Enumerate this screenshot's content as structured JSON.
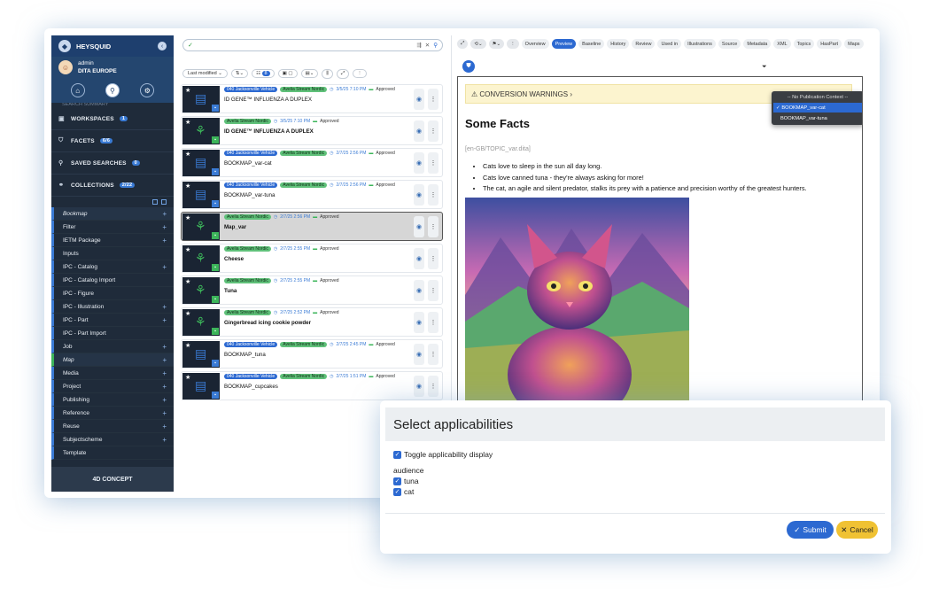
{
  "sidebar": {
    "brand": "HEYSQUID",
    "user_name": "admin",
    "user_org": "DITA EUROPE",
    "top_partial": "SEARCH SUMMARY",
    "sections": [
      {
        "label": "WORKSPACES",
        "badge": "1",
        "icon": "briefcase-icon"
      },
      {
        "label": "FACETS",
        "badge": "6/6",
        "icon": "tag-icon"
      },
      {
        "label": "SAVED SEARCHES",
        "badge": "0",
        "icon": "search-icon"
      },
      {
        "label": "COLLECTIONS",
        "badge": "2/22",
        "icon": "link-icon"
      }
    ],
    "items": [
      {
        "label": "Bookmap",
        "plus": true,
        "italic": true,
        "green": false
      },
      {
        "label": "Filter",
        "plus": true,
        "italic": false,
        "green": false
      },
      {
        "label": "IETM Package",
        "plus": true,
        "italic": false,
        "green": false
      },
      {
        "label": "Inputs",
        "plus": false,
        "italic": false,
        "green": false
      },
      {
        "label": "IPC - Catalog",
        "plus": true,
        "italic": false,
        "green": false
      },
      {
        "label": "IPC - Catalog Import",
        "plus": false,
        "italic": false,
        "green": false
      },
      {
        "label": "IPC - Figure",
        "plus": false,
        "italic": false,
        "green": false
      },
      {
        "label": "IPC - Illustration",
        "plus": true,
        "italic": false,
        "green": false
      },
      {
        "label": "IPC - Part",
        "plus": true,
        "italic": false,
        "green": false
      },
      {
        "label": "IPC - Part Import",
        "plus": false,
        "italic": false,
        "green": false
      },
      {
        "label": "Job",
        "plus": true,
        "italic": false,
        "green": false
      },
      {
        "label": "Map",
        "plus": true,
        "italic": true,
        "green": true
      },
      {
        "label": "Media",
        "plus": true,
        "italic": false,
        "green": false
      },
      {
        "label": "Project",
        "plus": true,
        "italic": false,
        "green": false
      },
      {
        "label": "Publishing",
        "plus": true,
        "italic": false,
        "green": false
      },
      {
        "label": "Reference",
        "plus": true,
        "italic": false,
        "green": false
      },
      {
        "label": "Reuse",
        "plus": true,
        "italic": false,
        "green": false
      },
      {
        "label": "Subjectscheme",
        "plus": true,
        "italic": false,
        "green": false
      },
      {
        "label": "Template",
        "plus": false,
        "italic": false,
        "green": false
      }
    ],
    "footer": "4D CONCEPT"
  },
  "list": {
    "sort_label": "Last modified",
    "count_badge": "8",
    "rows": [
      {
        "tag1": "040 Jacksonville Vehicle",
        "tag1_color": "blue",
        "tag2": "Avelia Stream Nordic",
        "date": "3/5/25 7:10 PM",
        "status": "Approved",
        "title": "ID GENE™ INFLUENZA A DUPLEX",
        "bold": false,
        "kind": "doc",
        "selected": false
      },
      {
        "tag1": "Avelia Stream Nordic",
        "tag1_color": "green",
        "tag2": "",
        "date": "3/5/25 7:10 PM",
        "status": "Approved",
        "title": "ID GENE™ INFLUENZA A DUPLEX",
        "bold": true,
        "kind": "map",
        "selected": false
      },
      {
        "tag1": "040 Jacksonville Vehicle",
        "tag1_color": "blue",
        "tag2": "Avelia Stream Nordic",
        "date": "2/7/25 2:56 PM",
        "status": "Approved",
        "title": "BOOKMAP_var-cat",
        "bold": false,
        "kind": "doc",
        "selected": false
      },
      {
        "tag1": "040 Jacksonville Vehicle",
        "tag1_color": "blue",
        "tag2": "Avelia Stream Nordic",
        "date": "2/7/25 2:56 PM",
        "status": "Approved",
        "title": "BOOKMAP_var-tuna",
        "bold": false,
        "kind": "doc",
        "selected": false
      },
      {
        "tag1": "Avelia Stream Nordic",
        "tag1_color": "green",
        "tag2": "",
        "date": "2/7/25 2:56 PM",
        "status": "Approved",
        "title": "Map_var",
        "bold": true,
        "kind": "map",
        "selected": true
      },
      {
        "tag1": "Avelia Stream Nordic",
        "tag1_color": "green",
        "tag2": "",
        "date": "2/7/25 2:55 PM",
        "status": "Approved",
        "title": "Cheese",
        "bold": true,
        "kind": "map",
        "selected": false
      },
      {
        "tag1": "Avelia Stream Nordic",
        "tag1_color": "green",
        "tag2": "",
        "date": "2/7/25 2:55 PM",
        "status": "Approved",
        "title": "Tuna",
        "bold": true,
        "kind": "map",
        "selected": false
      },
      {
        "tag1": "Avelia Stream Nordic",
        "tag1_color": "green",
        "tag2": "",
        "date": "2/7/25 2:52 PM",
        "status": "Approved",
        "title": "Gingerbread icing cookie powder",
        "bold": true,
        "kind": "map",
        "selected": false
      },
      {
        "tag1": "040 Jacksonville Vehicle",
        "tag1_color": "blue",
        "tag2": "Avelia Stream Nordic",
        "date": "2/7/25 2:45 PM",
        "status": "Approved",
        "title": "BOOKMAP_tuna",
        "bold": false,
        "kind": "doc",
        "selected": false
      },
      {
        "tag1": "040 Jacksonville Vehicle",
        "tag1_color": "blue",
        "tag2": "Avelia Stream Nordic",
        "date": "2/7/25 1:51 PM",
        "status": "Approved",
        "title": "BOOKMAP_cupcakes",
        "bold": false,
        "kind": "doc",
        "selected": false
      }
    ]
  },
  "preview": {
    "tabs": [
      "Overview",
      "Preview",
      "Baseline",
      "History",
      "Review",
      "Used in",
      "Illustrations",
      "Source",
      "Metadata",
      "XML",
      "Topics",
      "HasPart",
      "Maps"
    ],
    "active_tab": "Preview",
    "warning": "CONVERSION WARNINGS",
    "title": "Some Facts",
    "path": "[en-GB/TOPIC_var.dita]",
    "bullets": [
      "Cats love to sleep in the sun all day long.",
      "Cats love canned tuna - they're always asking for more!",
      "The cat, an agile and silent predator, stalks its prey with a patience and precision worthy of the greatest hunters."
    ],
    "dropdown": {
      "header": "-- No Publication Context --",
      "options": [
        "BOOKMAP_var-cat",
        "BOOKMAP_var-tuna"
      ],
      "selected": "BOOKMAP_var-cat"
    }
  },
  "modal": {
    "title": "Select applicabilities",
    "toggle_label": "Toggle applicability display",
    "group_label": "audience",
    "options": [
      "tuna",
      "cat"
    ],
    "submit": "Submit",
    "cancel": "Cancel"
  },
  "colors": {
    "accent": "#2c69d1",
    "sidebar": "#1f2b3a",
    "green_tag": "#60c17a",
    "cancel": "#f0c233"
  }
}
